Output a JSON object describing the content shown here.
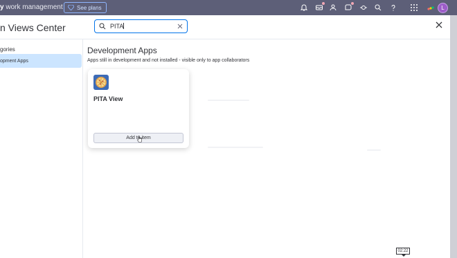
{
  "topbar": {
    "brand_bold": "y",
    "brand_rest": "work management",
    "see_plans": "See plans",
    "icons": [
      "bell-icon",
      "inbox-icon",
      "invite-members-icon",
      "updates-icon",
      "integrations-icon",
      "search-icon",
      "help-icon",
      "app-switcher-icon",
      "workspace-logo-icon"
    ],
    "avatar_initial": "L"
  },
  "modal": {
    "title": "n Views Center",
    "search": {
      "value": "PITA"
    }
  },
  "sidebar": {
    "heading": "gories",
    "items": [
      {
        "label": "opment Apps",
        "selected": true
      }
    ]
  },
  "main": {
    "section_title": "Development Apps",
    "section_subtitle": "Apps still in development and not installed - visible only to app collaborators",
    "apps": [
      {
        "name": "PITA View",
        "icon": "pizza-icon",
        "button_label": "Add to item"
      }
    ]
  },
  "overlay": {
    "time": "02:22"
  },
  "colors": {
    "topbar": "#5d5f78",
    "accent": "#0073ea",
    "selected": "#cce5ff",
    "avatar": "#9d5dc9",
    "app_icon_bg": "#3d6bb6"
  }
}
